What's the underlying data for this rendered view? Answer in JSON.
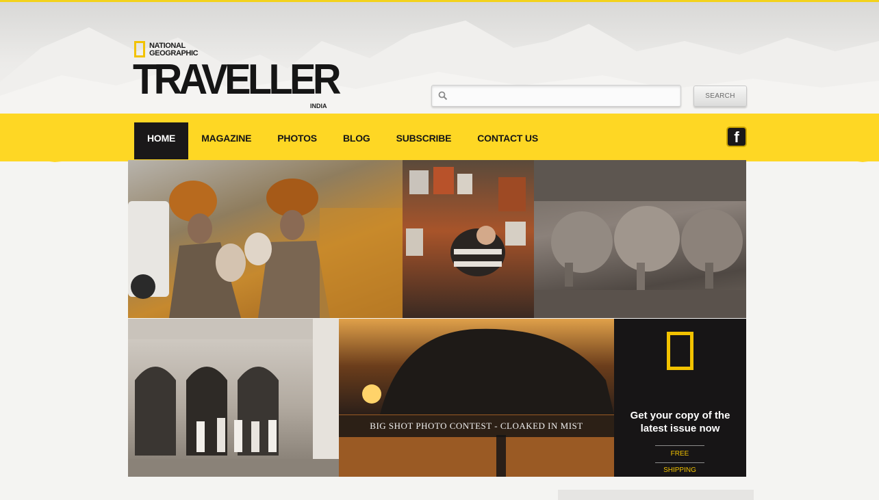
{
  "brand": {
    "ng_line1": "NATIONAL",
    "ng_line2": "GEOGRAPHIC",
    "title": "TRAVELLER",
    "edition": "INDIA"
  },
  "search": {
    "placeholder": "",
    "value": "",
    "button_label": "SEARCH"
  },
  "nav": {
    "items": [
      {
        "label": "HOME",
        "active": true
      },
      {
        "label": "MAGAZINE"
      },
      {
        "label": "PHOTOS"
      },
      {
        "label": "BLOG"
      },
      {
        "label": "SUBSCRIBE"
      },
      {
        "label": "CONTACT US"
      }
    ],
    "facebook_glyph": "f"
  },
  "gallery": {
    "contest_caption": "BIG SHOT PHOTO CONTEST - CLOAKED IN MIST"
  },
  "promo": {
    "title": "Get your copy of the latest issue now",
    "shipping": "FREE SHIPPING"
  },
  "colors": {
    "accent_yellow": "#fed724",
    "nav_active_bg": "#1a1819",
    "logo_yellow": "#f2c200"
  }
}
